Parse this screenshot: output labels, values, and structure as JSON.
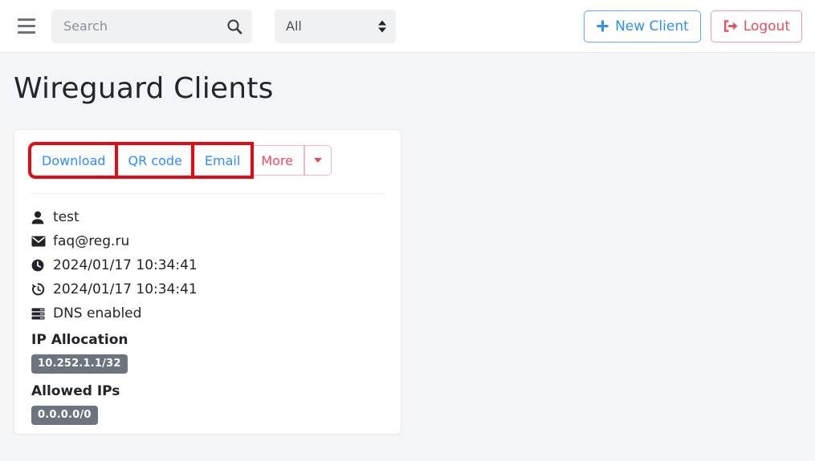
{
  "header": {
    "menu_icon": "hamburger-icon",
    "search": {
      "placeholder": "Search",
      "value": "",
      "icon": "search-icon"
    },
    "filter_select": {
      "value": "All",
      "icon": "sort-updown-icon"
    },
    "new_client_button": {
      "label": "New Client",
      "icon": "plus-icon",
      "color": "#2f8ef4"
    },
    "logout_button": {
      "label": "Logout",
      "icon": "sign-out-icon",
      "color": "#ea4b5a"
    }
  },
  "page": {
    "title": "Wireguard Clients",
    "background": "#f4f5f8"
  },
  "client_card": {
    "actions": [
      {
        "label": "Download",
        "highlighted": true
      },
      {
        "label": "QR code",
        "highlighted": true
      },
      {
        "label": "Email",
        "highlighted": true
      },
      {
        "label": "More",
        "highlighted": false
      }
    ],
    "dropdown_caret_icon": "chevron-down-icon",
    "details": [
      {
        "icon": "user-icon",
        "text": "test"
      },
      {
        "icon": "envelope-icon",
        "text": "faq@reg.ru"
      },
      {
        "icon": "clock-icon",
        "text": "2024/01/17 10:34:41"
      },
      {
        "icon": "clock-history-icon",
        "text": "2024/01/17 10:34:41"
      },
      {
        "icon": "server-icon",
        "text": "DNS enabled"
      }
    ],
    "ip_allocation": {
      "label": "IP Allocation",
      "values": [
        "10.252.1.1/32"
      ]
    },
    "allowed_ips": {
      "label": "Allowed IPs",
      "values": [
        "0.0.0.0/0"
      ]
    },
    "badge_color": "#6c757d"
  },
  "annotation": {
    "color": "#e50914",
    "targets": [
      "Download",
      "QR code",
      "Email"
    ]
  }
}
